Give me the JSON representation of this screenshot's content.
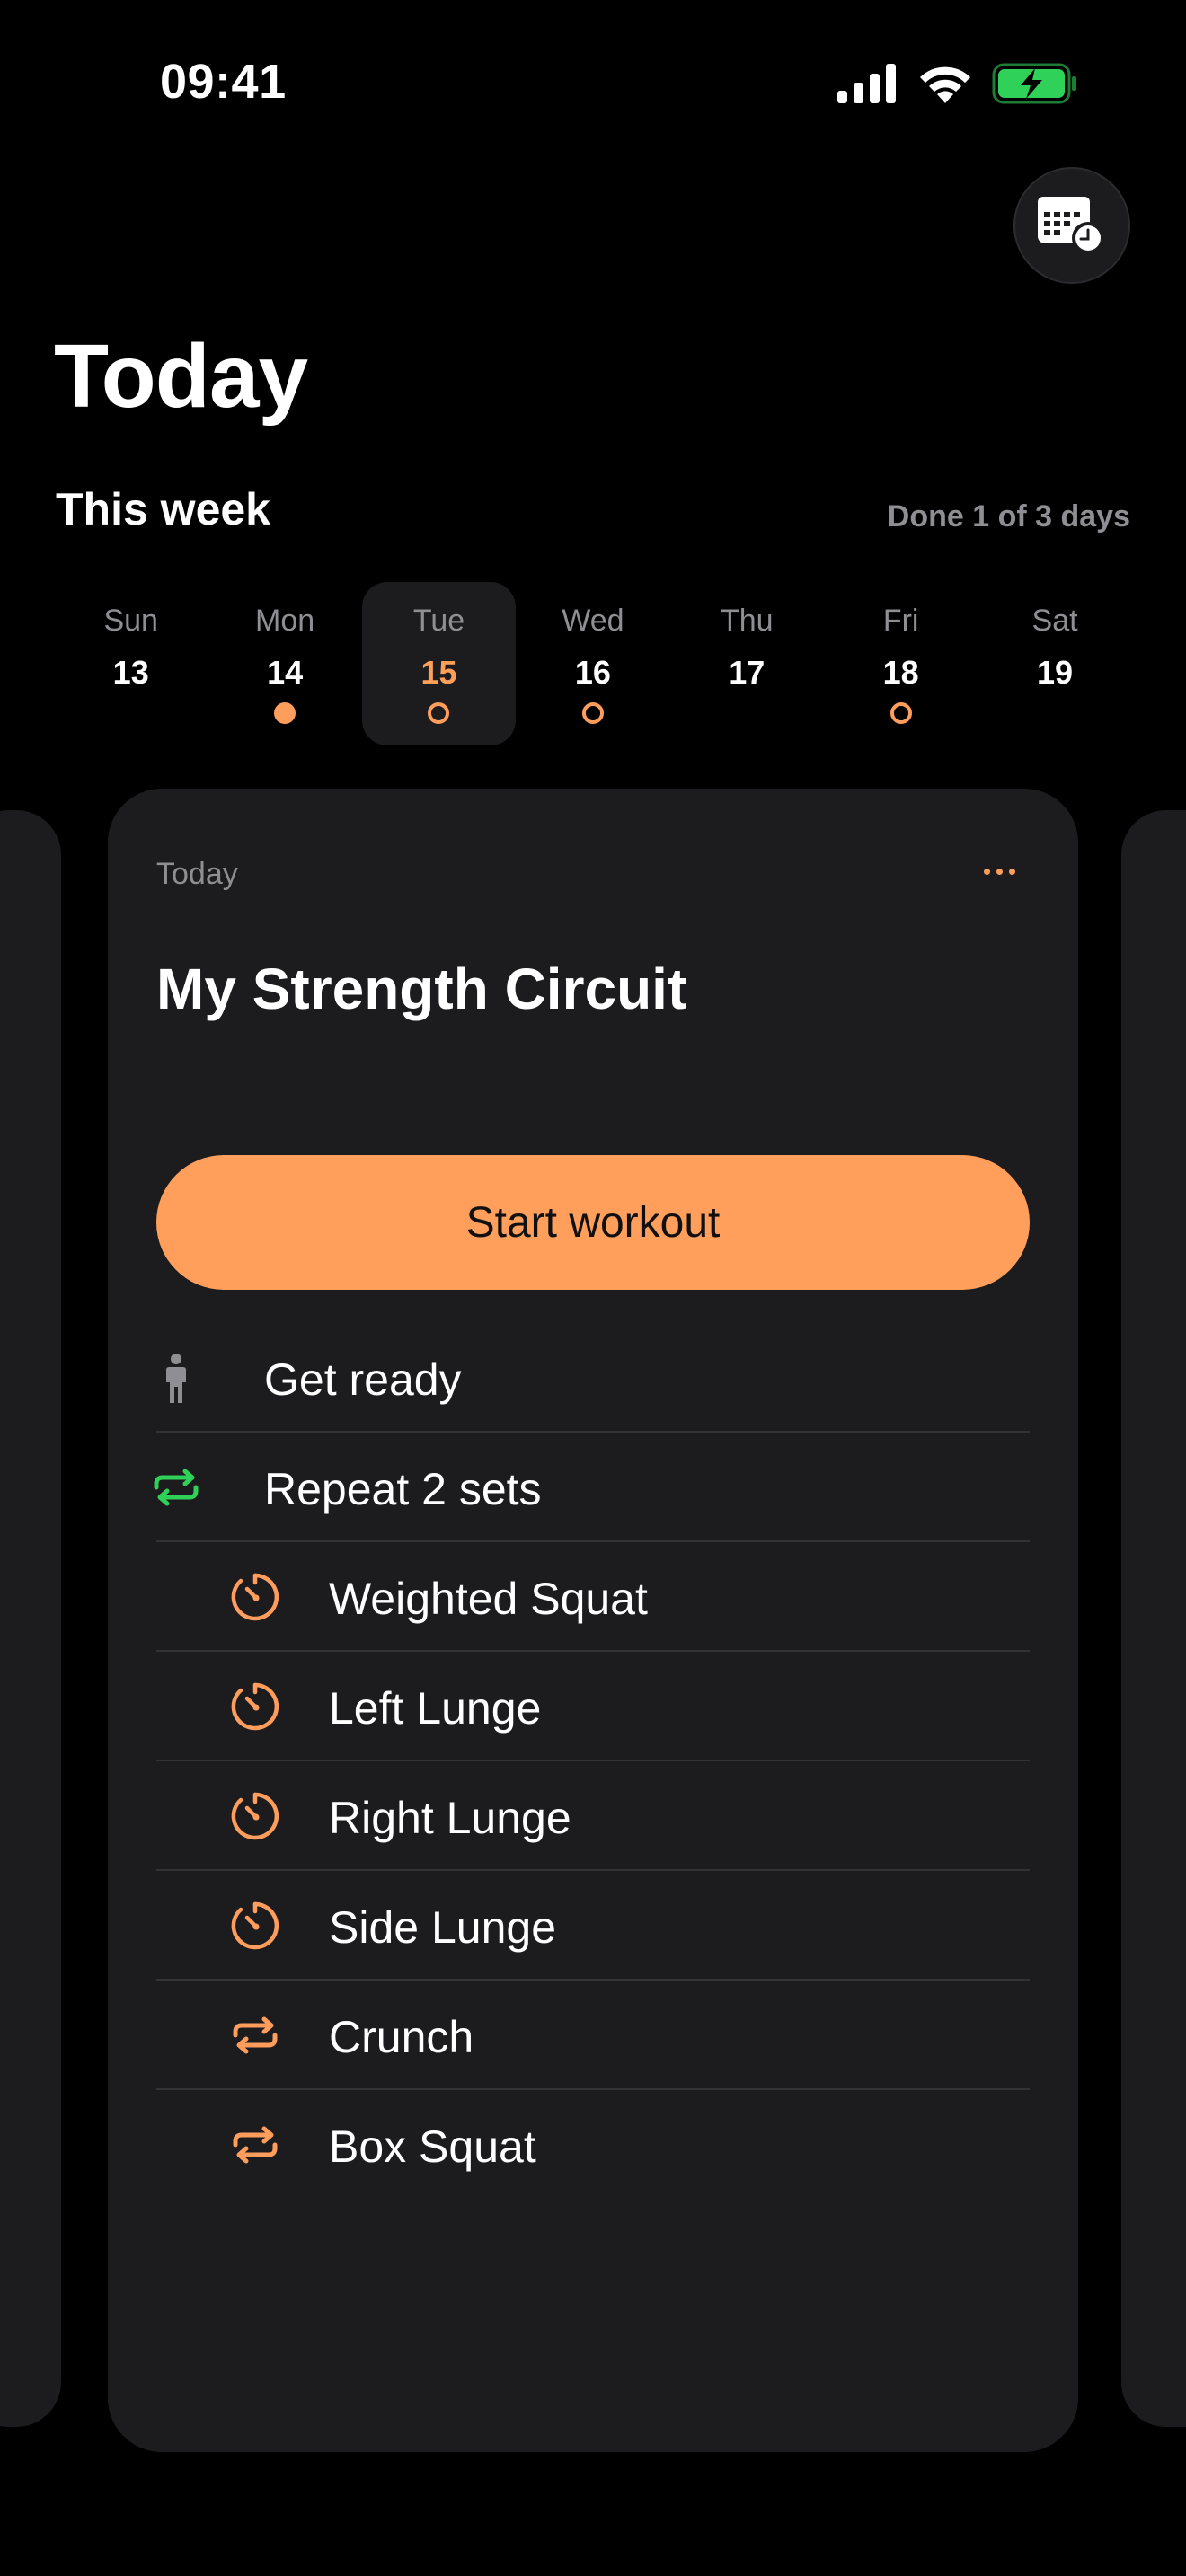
{
  "status_bar": {
    "time": "09:41"
  },
  "header": {
    "title": "Today",
    "calendar_icon": "calendar-clock-icon"
  },
  "week": {
    "title": "This week",
    "progress": "Done 1 of 3 days",
    "days": [
      {
        "name": "Sun",
        "num": "13",
        "dot": "none"
      },
      {
        "name": "Mon",
        "num": "14",
        "dot": "filled"
      },
      {
        "name": "Tue",
        "num": "15",
        "dot": "hollow",
        "selected": true
      },
      {
        "name": "Wed",
        "num": "16",
        "dot": "hollow"
      },
      {
        "name": "Thu",
        "num": "17",
        "dot": "none"
      },
      {
        "name": "Fri",
        "num": "18",
        "dot": "hollow"
      },
      {
        "name": "Sat",
        "num": "19",
        "dot": "none"
      }
    ]
  },
  "card": {
    "label": "Today",
    "title": "My Strength Circuit",
    "start_label": "Start workout",
    "steps": [
      {
        "label": "Get ready",
        "icon": "person-icon",
        "level": "top"
      },
      {
        "label": "Repeat 2 sets",
        "icon": "repeat-icon",
        "level": "top"
      },
      {
        "label": "Weighted Squat",
        "icon": "timer-icon",
        "level": "sub"
      },
      {
        "label": "Left Lunge",
        "icon": "timer-icon",
        "level": "sub"
      },
      {
        "label": "Right Lunge",
        "icon": "timer-icon",
        "level": "sub"
      },
      {
        "label": "Side Lunge",
        "icon": "timer-icon",
        "level": "sub"
      },
      {
        "label": "Crunch",
        "icon": "repeat-icon",
        "level": "sub"
      },
      {
        "label": "Box Squat",
        "icon": "repeat-icon",
        "level": "sub"
      }
    ]
  },
  "colors": {
    "accent": "#ff9f5b",
    "repeat_green": "#30d158",
    "card_bg": "#1c1c1e",
    "secondary_text": "#8e8e93"
  }
}
